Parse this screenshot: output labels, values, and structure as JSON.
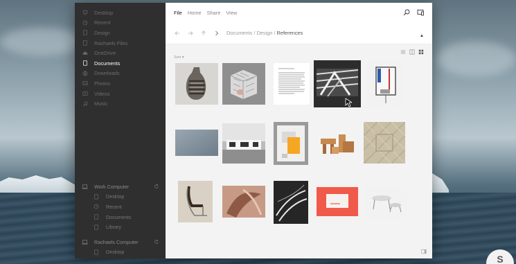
{
  "sidebar": {
    "items": [
      {
        "label": "Desktop",
        "icon": "monitor-icon"
      },
      {
        "label": "Recent",
        "icon": "clock-icon"
      },
      {
        "label": "Design",
        "icon": "document-icon"
      },
      {
        "label": "Rachaels Files",
        "icon": "document-icon"
      },
      {
        "label": "OneDrive",
        "icon": "cloud-icon"
      },
      {
        "label": "Documents",
        "icon": "document-icon",
        "active": true
      },
      {
        "label": "Downloads",
        "icon": "globe-icon"
      },
      {
        "label": "Photos",
        "icon": "image-icon"
      },
      {
        "label": "Videos",
        "icon": "video-icon"
      },
      {
        "label": "Music",
        "icon": "music-icon"
      }
    ],
    "computers": [
      {
        "name": "Work Computer",
        "items": [
          "Desktop",
          "Recent",
          "Documents",
          "Library"
        ]
      },
      {
        "name": "Rachaels Computer",
        "items": [
          "Desktop"
        ]
      }
    ]
  },
  "menu": {
    "file": "File",
    "home": "Home",
    "share": "Share",
    "view": "View"
  },
  "breadcrumb": {
    "part1": "Documents",
    "part2": "Design",
    "current": "References",
    "sep": "/"
  },
  "toolbar": {
    "sort_label": "Sort ▾"
  },
  "colors": {
    "sidebar_bg": "#2f2f2f",
    "content_bg": "#f3f3f3",
    "accent_red": "#f05a4a",
    "accent_orange": "#f5a623"
  },
  "thumbnails": [
    {
      "name": "striped-vase",
      "row": 1
    },
    {
      "name": "white-lattice-cube",
      "row": 1
    },
    {
      "name": "text-document-page",
      "row": 1
    },
    {
      "name": "black-white-architecture",
      "row": 1,
      "selected": true
    },
    {
      "name": "gallery-wall-art",
      "row": 1
    },
    {
      "name": "blue-grey-texture",
      "row": 2
    },
    {
      "name": "modern-house-photo",
      "row": 2
    },
    {
      "name": "orange-grey-poster",
      "row": 2
    },
    {
      "name": "wooden-furniture",
      "row": 2
    },
    {
      "name": "beige-pattern-quilt",
      "row": 2
    },
    {
      "name": "tubular-chair",
      "row": 3
    },
    {
      "name": "abstract-copper-sculpture",
      "row": 3
    },
    {
      "name": "light-streaks-photo",
      "row": 3
    },
    {
      "name": "red-business-card",
      "row": 3
    },
    {
      "name": "white-tables",
      "row": 3
    }
  ]
}
